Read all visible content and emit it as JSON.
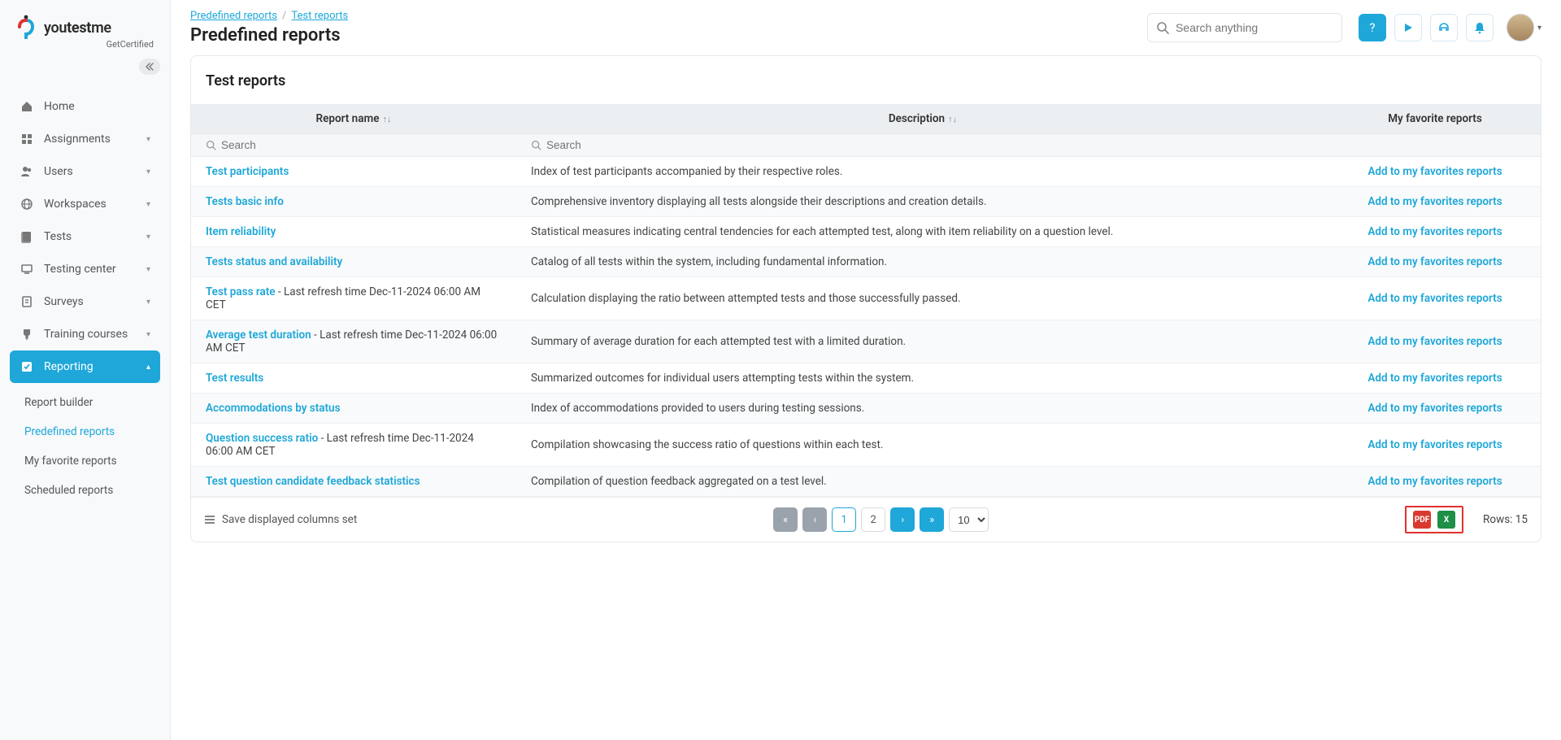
{
  "brand": {
    "name": "youtestme",
    "sub": "GetCertified"
  },
  "breadcrumbs": {
    "root": "Predefined reports",
    "leaf": "Test reports"
  },
  "page_title": "Predefined reports",
  "global_search_placeholder": "Search anything",
  "sidebar": {
    "items": [
      {
        "icon": "home-icon",
        "label": "Home",
        "expandable": false
      },
      {
        "icon": "assignments-icon",
        "label": "Assignments",
        "expandable": true
      },
      {
        "icon": "users-icon",
        "label": "Users",
        "expandable": true
      },
      {
        "icon": "workspaces-icon",
        "label": "Workspaces",
        "expandable": true
      },
      {
        "icon": "tests-icon",
        "label": "Tests",
        "expandable": true
      },
      {
        "icon": "testing-center-icon",
        "label": "Testing center",
        "expandable": true
      },
      {
        "icon": "surveys-icon",
        "label": "Surveys",
        "expandable": true
      },
      {
        "icon": "training-icon",
        "label": "Training courses",
        "expandable": true
      },
      {
        "icon": "reporting-icon",
        "label": "Reporting",
        "expandable": true,
        "active": true
      }
    ],
    "sub_reporting": [
      {
        "label": "Report builder"
      },
      {
        "label": "Predefined reports",
        "active": true
      },
      {
        "label": "My favorite reports"
      },
      {
        "label": "Scheduled reports"
      }
    ]
  },
  "panel": {
    "title": "Test reports",
    "columns": {
      "name": "Report name",
      "desc": "Description",
      "fav": "My favorite reports"
    },
    "filter_placeholder": "Search",
    "fav_action": "Add to my favorites reports",
    "rows": [
      {
        "name": "Test participants",
        "suffix": "",
        "desc": "Index of test participants accompanied by their respective roles."
      },
      {
        "name": "Tests basic info",
        "suffix": "",
        "desc": "Comprehensive inventory displaying all tests alongside their descriptions and creation details."
      },
      {
        "name": "Item reliability",
        "suffix": "",
        "desc": "Statistical measures indicating central tendencies for each attempted test, along with item reliability on a question level."
      },
      {
        "name": "Tests status and availability",
        "suffix": "",
        "desc": "Catalog of all tests within the system, including fundamental information."
      },
      {
        "name": "Test pass rate",
        "suffix": " - Last refresh time Dec-11-2024 06:00 AM CET",
        "desc": "Calculation displaying the ratio between attempted tests and those successfully passed."
      },
      {
        "name": "Average test duration",
        "suffix": " - Last refresh time Dec-11-2024 06:00 AM CET",
        "desc": "Summary of average duration for each attempted test with a limited duration."
      },
      {
        "name": "Test results",
        "suffix": "",
        "desc": "Summarized outcomes for individual users attempting tests within the system."
      },
      {
        "name": "Accommodations by status",
        "suffix": "",
        "desc": "Index of accommodations provided to users during testing sessions."
      },
      {
        "name": "Question success ratio",
        "suffix": " - Last refresh time Dec-11-2024 06:00 AM CET",
        "desc": "Compilation showcasing the success ratio of questions within each test."
      },
      {
        "name": "Test question candidate feedback statistics",
        "suffix": "",
        "desc": "Compilation of question feedback aggregated on a test level."
      }
    ]
  },
  "footer": {
    "save_cols": "Save displayed columns set",
    "pages": [
      "1",
      "2"
    ],
    "current_page": "1",
    "page_size": "10",
    "rows_label": "Rows: 15"
  }
}
